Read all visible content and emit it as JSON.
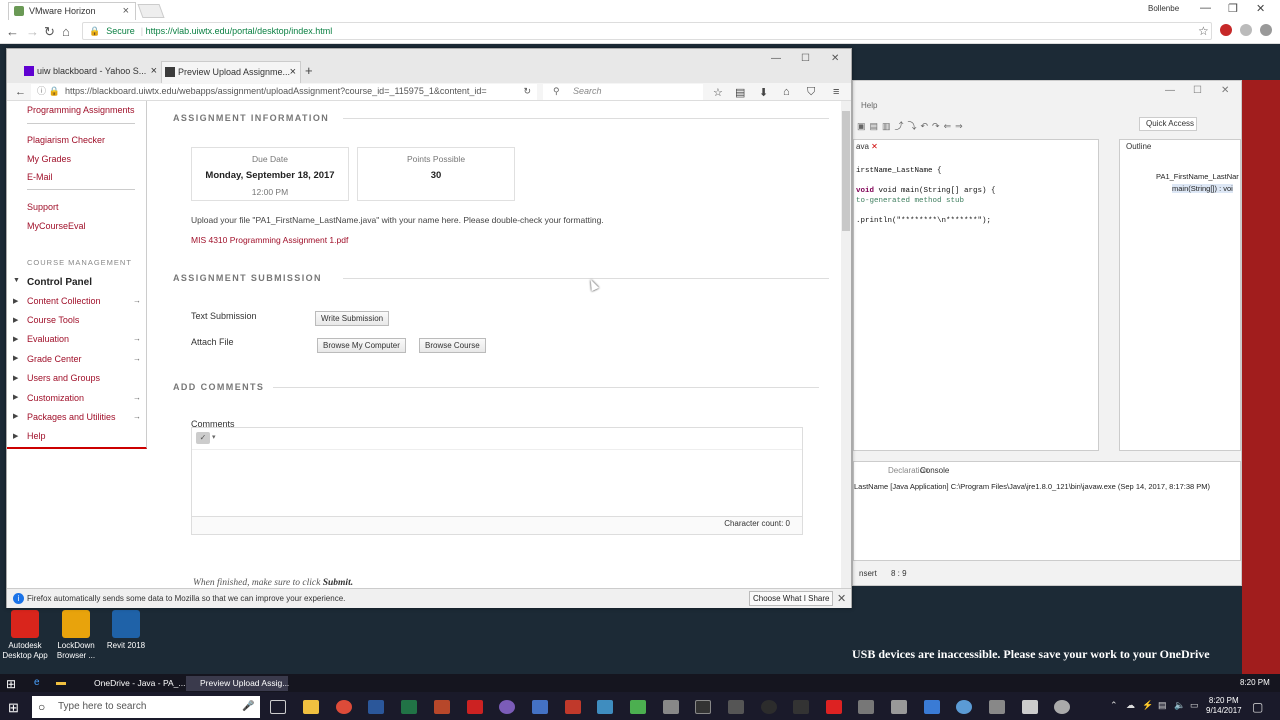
{
  "outer_browser": {
    "tab_title": "VMware Horizon",
    "user_badge": "Bollenbe",
    "secure_label": "Secure",
    "url": "https://vlab.uiwtx.edu/portal/desktop/index.html"
  },
  "firefox": {
    "tabs": [
      {
        "label": "uiw blackboard - Yahoo S...",
        "active": false
      },
      {
        "label": "Preview Upload Assignme...",
        "active": true
      }
    ],
    "url": "https://blackboard.uiwtx.edu/webapps/assignment/uploadAssignment?course_id=_115975_1&content_id=",
    "search_placeholder": "Search",
    "notification": {
      "message": "Firefox automatically sends some data to Mozilla so that we can improve your experience.",
      "button": "Choose What I Share"
    }
  },
  "sidebar": {
    "top_links": [
      "Programming Assignments",
      "Plagiarism Checker",
      "My Grades",
      "E-Mail",
      "Support",
      "MyCourseEval"
    ],
    "section_title": "COURSE MANAGEMENT",
    "control_panel": "Control Panel",
    "cp_items": [
      {
        "label": "Content Collection",
        "arrow": true
      },
      {
        "label": "Course Tools",
        "arrow": false
      },
      {
        "label": "Evaluation",
        "arrow": true
      },
      {
        "label": "Grade Center",
        "arrow": true
      },
      {
        "label": "Users and Groups",
        "arrow": false
      },
      {
        "label": "Customization",
        "arrow": true
      },
      {
        "label": "Packages and Utilities",
        "arrow": true
      },
      {
        "label": "Help",
        "arrow": false
      }
    ]
  },
  "assignment": {
    "info_heading": "ASSIGNMENT INFORMATION",
    "due_label": "Due Date",
    "due_date": "Monday, September 18, 2017",
    "due_time": "12:00 PM",
    "points_label": "Points Possible",
    "points": "30",
    "instructions": "Upload your file \"PA1_FirstName_LastName.java\" with your name here.  Please double-check your formatting.",
    "attachment": "MIS 4310 Programming Assignment 1.pdf",
    "submission_heading": "ASSIGNMENT SUBMISSION",
    "text_submission_label": "Text Submission",
    "write_submission_button": "Write Submission",
    "attach_file_label": "Attach File",
    "browse_computer_button": "Browse My Computer",
    "browse_course_button": "Browse Course",
    "comments_heading": "ADD COMMENTS",
    "comments_label": "Comments",
    "char_count": "Character count: 0",
    "finish_prefix": "When finished, make sure to click ",
    "finish_bold": "Submit."
  },
  "eclipse": {
    "menu_help": "Help",
    "quick_access": "Quick Access",
    "editor_tab": "ava",
    "code_lines": [
      "irstName_LastName {",
      "",
      "void main(String[] args) {",
      "to-generated method stub",
      "",
      ".println(\"********\\n*******\");"
    ],
    "outline_tab": "Outline",
    "outline_items": [
      "PA1_FirstName_LastNar",
      "main(String[]) : voi"
    ],
    "declaration_tab": "Declaration",
    "console_tab": "Console",
    "console_line": "LastName [Java Application] C:\\Program Files\\Java\\jre1.8.0_121\\bin\\javaw.exe (Sep 14, 2017, 8:17:38 PM)",
    "status_insert": "nsert",
    "status_pos": "8 : 9"
  },
  "desktop": {
    "icons": [
      {
        "label": "Autodesk Desktop App",
        "color": "#d9251c"
      },
      {
        "label": "LockDown Browser ...",
        "color": "#e8a30c"
      },
      {
        "label": "Revit 2018",
        "color": "#1f62a8"
      }
    ],
    "usb_message": "USB devices are inaccessible. Please save your work to your OneDrive"
  },
  "taskbar": {
    "remote_tabs": [
      {
        "label": "OneDrive - Java - PA_...",
        "active": false
      },
      {
        "label": "Preview Upload Assig...",
        "active": true
      }
    ],
    "remote_clock": "8:20 PM",
    "search_placeholder": "Type here to search",
    "clock_time": "8:20 PM",
    "clock_date": "9/14/2017"
  },
  "colors": {
    "bb_red": "#a0102a",
    "desktop_red": "#9e1b1b"
  }
}
